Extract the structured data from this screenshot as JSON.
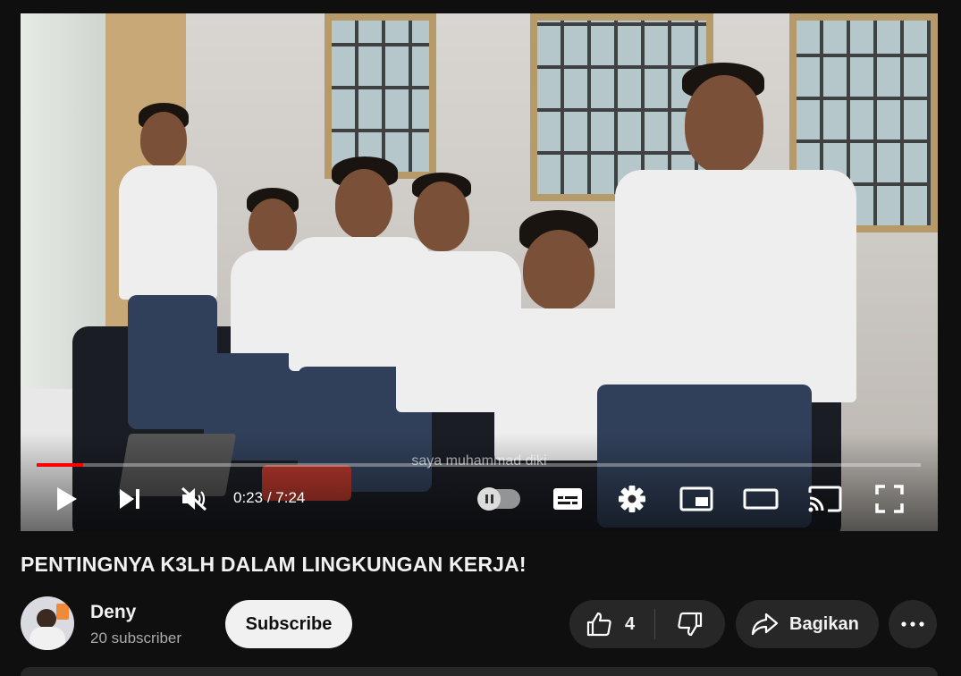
{
  "video": {
    "caption": "saya muhammad diki",
    "progress_fraction": 0.053,
    "current_time": "0:23",
    "duration": "7:24",
    "time_separator": " / "
  },
  "controls": {
    "icons": [
      "play-icon",
      "next-icon",
      "mute-icon",
      "autoplay-toggle",
      "subtitles-icon",
      "settings-icon",
      "miniplayer-icon",
      "theater-icon",
      "cast-icon",
      "fullscreen-icon"
    ]
  },
  "title": "PENTINGNYA K3LH DALAM LINGKUNGAN KERJA!",
  "channel": {
    "name": "Deny",
    "subscribers": "20 subscriber",
    "subscribe_label": "Subscribe"
  },
  "actions": {
    "like_count": "4",
    "share_label": "Bagikan"
  },
  "colors": {
    "background": "#0f0f0f",
    "progress": "#ff0000",
    "pill": "#272727",
    "subscribe_bg": "#f1f1f1"
  }
}
